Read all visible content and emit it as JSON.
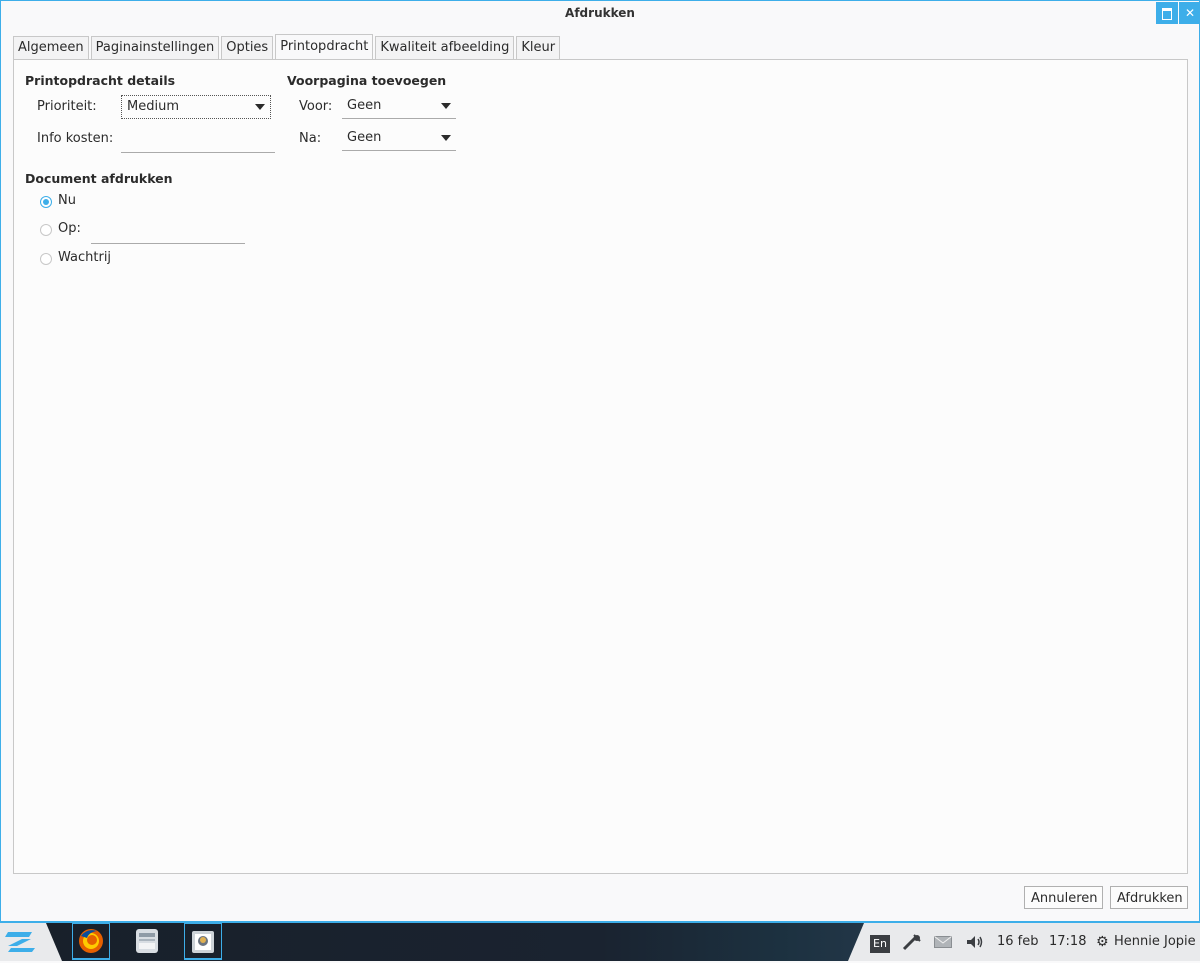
{
  "window": {
    "title": "Afdrukken"
  },
  "tabs": [
    {
      "label": "Algemeen"
    },
    {
      "label": "Paginainstellingen"
    },
    {
      "label": "Opties"
    },
    {
      "label": "Printopdracht"
    },
    {
      "label": "Kwaliteit afbeelding"
    },
    {
      "label": "Kleur"
    }
  ],
  "job_details": {
    "title": "Printopdracht details",
    "priority_label": "Prioriteit:",
    "priority_value": "Medium",
    "billing_label": "Info kosten:",
    "billing_value": ""
  },
  "cover_page": {
    "title": "Voorpagina toevoegen",
    "before_label": "Voor:",
    "before_value": "Geen",
    "after_label": "Na:",
    "after_value": "Geen"
  },
  "print_document": {
    "title": "Document afdrukken",
    "now_label": "Nu",
    "at_label": "Op:",
    "at_value": "",
    "hold_label": "Wachtrij",
    "selected": "now"
  },
  "buttons": {
    "cancel": "Annuleren",
    "print": "Afdrukken"
  },
  "taskbar": {
    "language": "En",
    "date": "16 feb",
    "time": "17:18",
    "user": "Hennie Jopie"
  },
  "colors": {
    "accent": "#3daee9"
  }
}
